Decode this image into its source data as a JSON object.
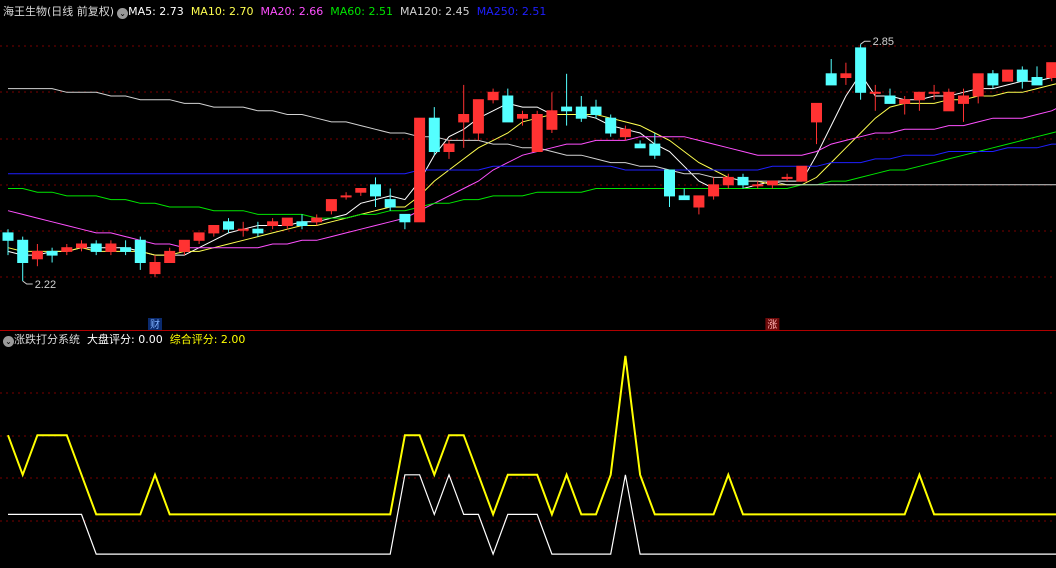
{
  "colors": {
    "bg": "#000000",
    "up": "#ff3232",
    "down": "#54ffff",
    "grid": "#7a0000",
    "frame": "#b00000",
    "ma5": "#ffffff",
    "ma10": "#ffff50",
    "ma20": "#ff50ff",
    "ma60": "#00e600",
    "ma120": "#d2d2d2",
    "ma250": "#1f1fff",
    "score1": "#ffff00",
    "score2": "#ffffff"
  },
  "header": {
    "title": "海王生物(日线 前复权)",
    "ma5": "MA5: 2.73",
    "ma10": "MA10: 2.70",
    "ma20": "MA20: 2.66",
    "ma60": "MA60: 2.51",
    "ma120": "MA120: 2.45",
    "ma250": "MA250: 2.51"
  },
  "sub_header": {
    "title": "涨跌打分系统",
    "dapan": "大盘评分: 0.00",
    "zonghe": "综合评分: 2.00"
  },
  "chart_data": [
    {
      "type": "candlestick",
      "title": "海王生物(日线 前复权)",
      "ylim": [
        2.12,
        2.92
      ],
      "annotations": {
        "high": "2.85",
        "low": "2.22",
        "markers": [
          "财",
          "涨"
        ]
      },
      "candles": [
        [
          2.35,
          2.36,
          2.29,
          2.33
        ],
        [
          2.33,
          2.34,
          2.22,
          2.27
        ],
        [
          2.28,
          2.32,
          2.26,
          2.3
        ],
        [
          2.3,
          2.31,
          2.27,
          2.29
        ],
        [
          2.3,
          2.32,
          2.29,
          2.31
        ],
        [
          2.31,
          2.33,
          2.3,
          2.32
        ],
        [
          2.32,
          2.33,
          2.29,
          2.3
        ],
        [
          2.3,
          2.33,
          2.29,
          2.32
        ],
        [
          2.31,
          2.33,
          2.29,
          2.3
        ],
        [
          2.33,
          2.34,
          2.25,
          2.27
        ],
        [
          2.24,
          2.29,
          2.23,
          2.27
        ],
        [
          2.27,
          2.31,
          2.27,
          2.3
        ],
        [
          2.3,
          2.33,
          2.29,
          2.33
        ],
        [
          2.33,
          2.35,
          2.32,
          2.35
        ],
        [
          2.35,
          2.37,
          2.34,
          2.37
        ],
        [
          2.38,
          2.39,
          2.35,
          2.36
        ],
        [
          2.36,
          2.38,
          2.34,
          2.36
        ],
        [
          2.36,
          2.38,
          2.34,
          2.35
        ],
        [
          2.37,
          2.39,
          2.36,
          2.38
        ],
        [
          2.37,
          2.39,
          2.36,
          2.39
        ],
        [
          2.38,
          2.4,
          2.36,
          2.37
        ],
        [
          2.38,
          2.4,
          2.37,
          2.39
        ],
        [
          2.41,
          2.44,
          2.4,
          2.44
        ],
        [
          2.45,
          2.46,
          2.44,
          2.45
        ],
        [
          2.46,
          2.47,
          2.45,
          2.47
        ],
        [
          2.48,
          2.5,
          2.42,
          2.45
        ],
        [
          2.44,
          2.47,
          2.41,
          2.42
        ],
        [
          2.4,
          2.4,
          2.36,
          2.38
        ],
        [
          2.38,
          2.66,
          2.38,
          2.66
        ],
        [
          2.66,
          2.69,
          2.56,
          2.57
        ],
        [
          2.57,
          2.6,
          2.55,
          2.59
        ],
        [
          2.65,
          2.75,
          2.58,
          2.67
        ],
        [
          2.62,
          2.71,
          2.6,
          2.71
        ],
        [
          2.71,
          2.74,
          2.7,
          2.73
        ],
        [
          2.72,
          2.74,
          2.65,
          2.65
        ],
        [
          2.66,
          2.68,
          2.64,
          2.67
        ],
        [
          2.57,
          2.68,
          2.57,
          2.67
        ],
        [
          2.63,
          2.73,
          2.62,
          2.68
        ],
        [
          2.69,
          2.78,
          2.64,
          2.68
        ],
        [
          2.69,
          2.72,
          2.65,
          2.66
        ],
        [
          2.69,
          2.71,
          2.66,
          2.67
        ],
        [
          2.66,
          2.67,
          2.61,
          2.62
        ],
        [
          2.61,
          2.64,
          2.6,
          2.63
        ],
        [
          2.59,
          2.6,
          2.58,
          2.58
        ],
        [
          2.59,
          2.62,
          2.55,
          2.56
        ],
        [
          2.52,
          2.52,
          2.42,
          2.45
        ],
        [
          2.45,
          2.47,
          2.44,
          2.44
        ],
        [
          2.42,
          2.45,
          2.4,
          2.45
        ],
        [
          2.45,
          2.5,
          2.44,
          2.48
        ],
        [
          2.48,
          2.51,
          2.47,
          2.5
        ],
        [
          2.5,
          2.51,
          2.47,
          2.48
        ],
        [
          2.48,
          2.49,
          2.47,
          2.48
        ],
        [
          2.48,
          2.49,
          2.47,
          2.49
        ],
        [
          2.5,
          2.51,
          2.49,
          2.5
        ],
        [
          2.49,
          2.52,
          2.49,
          2.53
        ],
        [
          2.65,
          2.68,
          2.59,
          2.7
        ],
        [
          2.78,
          2.82,
          2.77,
          2.75
        ],
        [
          2.77,
          2.81,
          2.75,
          2.78
        ],
        [
          2.85,
          2.86,
          2.71,
          2.73
        ],
        [
          2.73,
          2.75,
          2.68,
          2.73
        ],
        [
          2.72,
          2.74,
          2.7,
          2.7
        ],
        [
          2.7,
          2.72,
          2.67,
          2.71
        ],
        [
          2.71,
          2.73,
          2.68,
          2.73
        ],
        [
          2.73,
          2.75,
          2.71,
          2.73
        ],
        [
          2.68,
          2.74,
          2.68,
          2.73
        ],
        [
          2.7,
          2.74,
          2.65,
          2.72
        ],
        [
          2.72,
          2.75,
          2.7,
          2.78
        ],
        [
          2.78,
          2.79,
          2.74,
          2.75
        ],
        [
          2.76,
          2.79,
          2.76,
          2.79
        ],
        [
          2.79,
          2.8,
          2.74,
          2.76
        ],
        [
          2.77,
          2.8,
          2.75,
          2.75
        ],
        [
          2.77,
          2.81,
          2.76,
          2.81
        ],
        [
          2.81,
          2.82,
          2.78,
          2.78
        ]
      ],
      "series": [
        {
          "name": "MA5",
          "color": "#ffffff",
          "values": [
            2.3,
            2.29,
            2.29,
            2.3,
            2.3,
            2.31,
            2.31,
            2.31,
            2.31,
            2.3,
            2.29,
            2.29,
            2.29,
            2.31,
            2.33,
            2.35,
            2.36,
            2.37,
            2.37,
            2.37,
            2.38,
            2.38,
            2.39,
            2.4,
            2.43,
            2.44,
            2.45,
            2.44,
            2.49,
            2.56,
            2.61,
            2.63,
            2.66,
            2.68,
            2.7,
            2.69,
            2.69,
            2.67,
            2.67,
            2.67,
            2.66,
            2.64,
            2.63,
            2.62,
            2.59,
            2.57,
            2.53,
            2.49,
            2.47,
            2.47,
            2.47,
            2.48,
            2.49,
            2.49,
            2.49,
            2.56,
            2.64,
            2.72,
            2.78,
            2.72,
            2.72,
            2.71,
            2.71,
            2.72,
            2.72,
            2.73,
            2.74,
            2.74,
            2.75,
            2.76,
            2.76,
            2.77,
            2.79
          ]
        },
        {
          "name": "MA10",
          "color": "#ffff50",
          "values": [
            2.31,
            2.3,
            2.3,
            2.3,
            2.3,
            2.31,
            2.3,
            2.3,
            2.3,
            2.3,
            2.29,
            2.29,
            2.3,
            2.3,
            2.31,
            2.32,
            2.33,
            2.34,
            2.35,
            2.36,
            2.37,
            2.37,
            2.38,
            2.39,
            2.4,
            2.41,
            2.42,
            2.42,
            2.45,
            2.49,
            2.52,
            2.55,
            2.58,
            2.6,
            2.62,
            2.65,
            2.66,
            2.67,
            2.67,
            2.67,
            2.67,
            2.66,
            2.65,
            2.64,
            2.62,
            2.6,
            2.57,
            2.54,
            2.52,
            2.5,
            2.49,
            2.49,
            2.48,
            2.48,
            2.48,
            2.5,
            2.54,
            2.58,
            2.62,
            2.66,
            2.69,
            2.7,
            2.7,
            2.7,
            2.71,
            2.71,
            2.72,
            2.72,
            2.73,
            2.73,
            2.74,
            2.75,
            2.76
          ]
        },
        {
          "name": "MA20",
          "color": "#ff50ff",
          "values": [
            2.41,
            2.4,
            2.39,
            2.38,
            2.37,
            2.36,
            2.35,
            2.35,
            2.34,
            2.33,
            2.32,
            2.32,
            2.31,
            2.31,
            2.31,
            2.31,
            2.31,
            2.31,
            2.32,
            2.32,
            2.33,
            2.33,
            2.34,
            2.35,
            2.36,
            2.37,
            2.38,
            2.39,
            2.41,
            2.43,
            2.45,
            2.47,
            2.49,
            2.52,
            2.54,
            2.56,
            2.57,
            2.58,
            2.59,
            2.59,
            2.6,
            2.6,
            2.6,
            2.61,
            2.61,
            2.61,
            2.61,
            2.6,
            2.59,
            2.58,
            2.57,
            2.56,
            2.56,
            2.56,
            2.56,
            2.57,
            2.59,
            2.6,
            2.61,
            2.62,
            2.62,
            2.63,
            2.63,
            2.63,
            2.64,
            2.64,
            2.65,
            2.66,
            2.66,
            2.66,
            2.67,
            2.68,
            2.7
          ]
        },
        {
          "name": "MA60",
          "color": "#00e600",
          "values": [
            2.47,
            2.47,
            2.46,
            2.46,
            2.45,
            2.45,
            2.45,
            2.44,
            2.44,
            2.43,
            2.43,
            2.42,
            2.42,
            2.42,
            2.41,
            2.41,
            2.41,
            2.4,
            2.4,
            2.4,
            2.4,
            2.39,
            2.39,
            2.39,
            2.4,
            2.4,
            2.41,
            2.41,
            2.42,
            2.43,
            2.43,
            2.44,
            2.44,
            2.45,
            2.45,
            2.45,
            2.46,
            2.46,
            2.46,
            2.46,
            2.47,
            2.47,
            2.47,
            2.47,
            2.47,
            2.47,
            2.47,
            2.47,
            2.47,
            2.47,
            2.47,
            2.47,
            2.47,
            2.47,
            2.48,
            2.48,
            2.49,
            2.49,
            2.5,
            2.51,
            2.52,
            2.52,
            2.53,
            2.54,
            2.55,
            2.56,
            2.57,
            2.58,
            2.59,
            2.6,
            2.61,
            2.62,
            2.63
          ]
        },
        {
          "name": "MA120",
          "color": "#d2d2d2",
          "values": [
            2.74,
            2.74,
            2.74,
            2.74,
            2.73,
            2.73,
            2.73,
            2.72,
            2.72,
            2.71,
            2.71,
            2.71,
            2.7,
            2.7,
            2.69,
            2.69,
            2.69,
            2.68,
            2.68,
            2.67,
            2.67,
            2.66,
            2.65,
            2.65,
            2.64,
            2.63,
            2.62,
            2.62,
            2.61,
            2.61,
            2.6,
            2.6,
            2.6,
            2.59,
            2.59,
            2.58,
            2.58,
            2.57,
            2.56,
            2.56,
            2.55,
            2.54,
            2.54,
            2.53,
            2.53,
            2.52,
            2.51,
            2.51,
            2.5,
            2.5,
            2.49,
            2.49,
            2.49,
            2.48,
            2.48,
            2.48,
            2.48,
            2.48,
            2.48,
            2.48,
            2.48,
            2.48,
            2.48,
            2.48,
            2.48,
            2.48,
            2.48,
            2.48,
            2.48,
            2.48,
            2.48,
            2.48,
            2.48
          ]
        },
        {
          "name": "MA250",
          "color": "#1f1fff",
          "values": [
            2.51,
            2.51,
            2.51,
            2.51,
            2.51,
            2.51,
            2.51,
            2.51,
            2.51,
            2.51,
            2.51,
            2.51,
            2.51,
            2.51,
            2.51,
            2.51,
            2.51,
            2.51,
            2.51,
            2.51,
            2.51,
            2.51,
            2.51,
            2.51,
            2.51,
            2.51,
            2.51,
            2.51,
            2.52,
            2.52,
            2.52,
            2.52,
            2.52,
            2.53,
            2.53,
            2.53,
            2.53,
            2.53,
            2.53,
            2.53,
            2.53,
            2.53,
            2.52,
            2.52,
            2.52,
            2.52,
            2.52,
            2.52,
            2.52,
            2.52,
            2.52,
            2.52,
            2.53,
            2.53,
            2.53,
            2.53,
            2.54,
            2.54,
            2.54,
            2.55,
            2.55,
            2.56,
            2.56,
            2.56,
            2.57,
            2.57,
            2.57,
            2.57,
            2.58,
            2.58,
            2.58,
            2.59,
            2.59
          ]
        }
      ]
    },
    {
      "type": "line",
      "title": "涨跌打分系统",
      "ylim": [
        -0.2,
        5.2
      ],
      "series": [
        {
          "name": "综合评分",
          "color": "#ffff00",
          "values": [
            3,
            2,
            3,
            3,
            3,
            2,
            1,
            1,
            1,
            1,
            2,
            1,
            1,
            1,
            1,
            1,
            1,
            1,
            1,
            1,
            1,
            1,
            1,
            1,
            1,
            1,
            1,
            3,
            3,
            2,
            3,
            3,
            2,
            1,
            2,
            2,
            2,
            1,
            2,
            1,
            1,
            2,
            5,
            2,
            1,
            1,
            1,
            1,
            1,
            2,
            1,
            1,
            1,
            1,
            1,
            1,
            1,
            1,
            1,
            1,
            1,
            1,
            2,
            1,
            1,
            1,
            1,
            1,
            1,
            1,
            1,
            1,
            1
          ]
        },
        {
          "name": "大盘评分",
          "color": "#ffffff",
          "values": [
            1,
            1,
            1,
            1,
            1,
            1,
            0,
            0,
            0,
            0,
            0,
            0,
            0,
            0,
            0,
            0,
            0,
            0,
            0,
            0,
            0,
            0,
            0,
            0,
            0,
            0,
            0,
            2,
            2,
            1,
            2,
            1,
            1,
            0,
            1,
            1,
            1,
            0,
            0,
            0,
            0,
            0,
            2,
            0,
            0,
            0,
            0,
            0,
            0,
            0,
            0,
            0,
            0,
            0,
            0,
            0,
            0,
            0,
            0,
            0,
            0,
            0,
            0,
            0,
            0,
            0,
            0,
            0,
            0,
            0,
            0,
            0,
            0
          ]
        }
      ]
    }
  ]
}
